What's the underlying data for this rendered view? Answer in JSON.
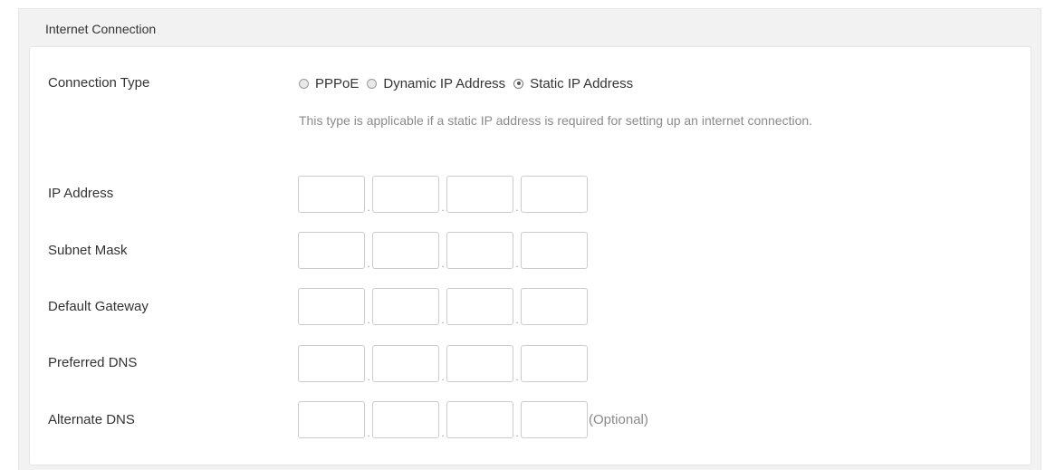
{
  "section": {
    "title": "Internet Connection"
  },
  "connection_type": {
    "label": "Connection Type",
    "options": [
      {
        "label": "PPPoE",
        "selected": false
      },
      {
        "label": "Dynamic IP Address",
        "selected": false
      },
      {
        "label": "Static IP Address",
        "selected": true
      }
    ],
    "help_text": "This type is applicable if a static IP address is required for setting up an internet connection."
  },
  "fields": [
    {
      "label": "IP Address",
      "octets": [
        "",
        "",
        "",
        ""
      ],
      "note": ""
    },
    {
      "label": "Subnet Mask",
      "octets": [
        "",
        "",
        "",
        ""
      ],
      "note": ""
    },
    {
      "label": "Default Gateway",
      "octets": [
        "",
        "",
        "",
        ""
      ],
      "note": ""
    },
    {
      "label": "Preferred DNS",
      "octets": [
        "",
        "",
        "",
        ""
      ],
      "note": ""
    },
    {
      "label": "Alternate DNS",
      "octets": [
        "",
        "",
        "",
        ""
      ],
      "note": "(Optional)"
    }
  ],
  "separator": "."
}
